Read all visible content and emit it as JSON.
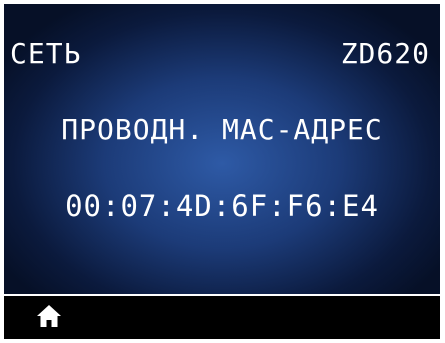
{
  "header": {
    "left": "СЕТЬ",
    "right": "ZD620"
  },
  "content": {
    "label": "ПРОВОДН. MAC-АДРЕС",
    "value": "00:07:4D:6F:F6:E4"
  },
  "footer": {
    "home_icon": "home-icon"
  },
  "colors": {
    "background": "#000000",
    "gradient_center": "#2e5aa6",
    "gradient_edge": "#061027",
    "text": "#ffffff"
  }
}
